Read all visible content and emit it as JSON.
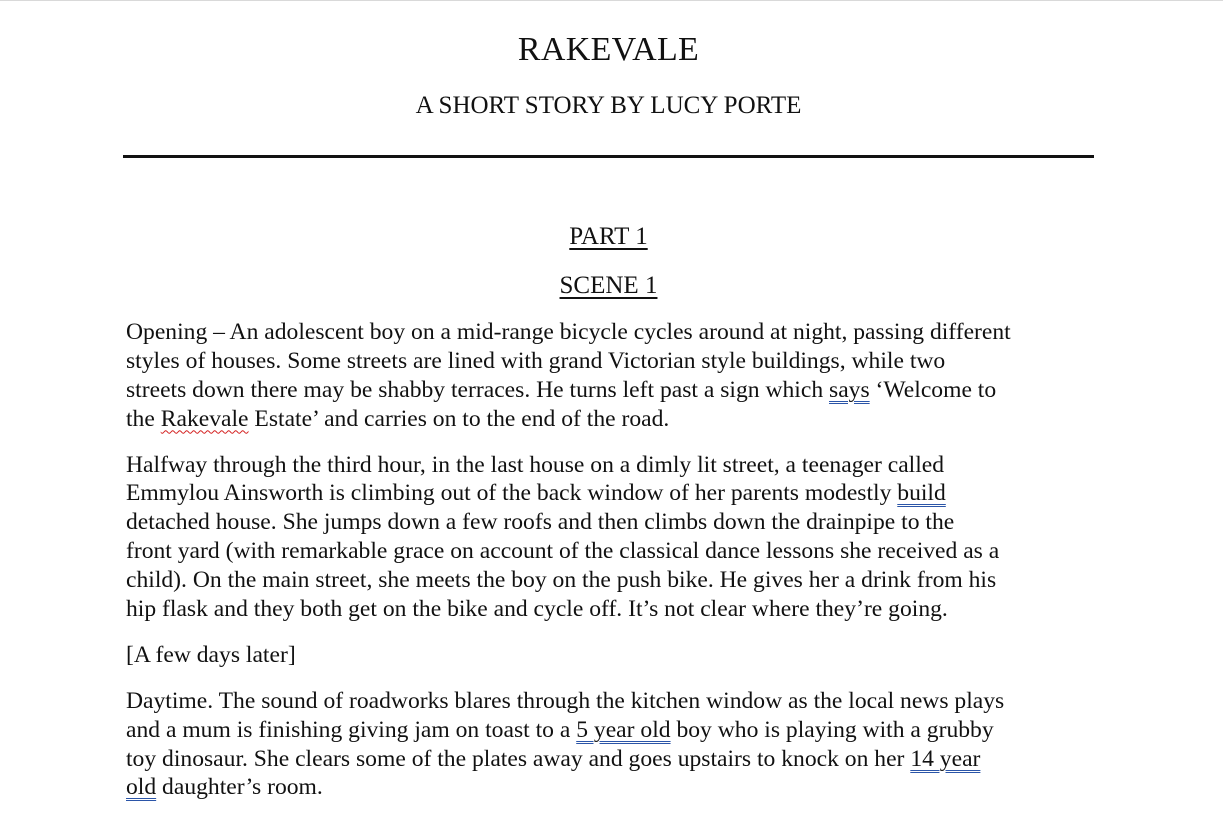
{
  "document": {
    "title": "RAKEVALE",
    "subtitle": "A SHORT STORY BY LUCY PORTE",
    "part_heading": "PART 1",
    "scene_heading": "SCENE 1"
  },
  "paragraphs": {
    "p1": {
      "l1": "Opening – An adolescent boy on a mid-range bicycle cycles around at night, passing different",
      "l2": "styles of houses. Some streets are lined with grand Victorian style buildings, while two",
      "l3a": "streets down there may be shabby terraces. He turns left past a sign which ",
      "l3b": "says",
      "l3c": " ‘Welcome to",
      "l4a": "the ",
      "l4b": "Rakevale",
      "l4c": " Estate’ and carries on to the end of the road."
    },
    "p2": {
      "l1": "Halfway through the third hour, in the last house on a dimly lit street, a teenager called",
      "l2a": "Emmylou Ainsworth is climbing out of the back window of her parents modestly ",
      "l2b": "build",
      "l3": "detached house. She jumps down a few roofs and then climbs down the drainpipe to the",
      "l4": "front yard (with remarkable grace on account of the classical dance lessons she received as a",
      "l5": "child). On the main street, she meets the boy on the push bike. He gives her a drink from his",
      "l6": "hip flask and they both get on the bike and cycle off. It’s not clear where they’re going."
    },
    "p3": {
      "l1": "[A few days later]"
    },
    "p4": {
      "l1": "Daytime. The sound of roadworks blares through the kitchen window as the local news plays",
      "l2a": "and a mum is finishing giving jam on toast to a ",
      "l2b": "5 year old",
      "l2c": " boy who is playing with a grubby",
      "l3a": "toy dinosaur. She clears some of the plates away and goes upstairs to knock on her ",
      "l3b": "14 year ",
      "l4a": "old",
      "l4b": " daughter’s room."
    }
  },
  "colors": {
    "text": "#111111",
    "grammar_underline": "#2b55a8",
    "spelling_underline": "#d42020"
  }
}
